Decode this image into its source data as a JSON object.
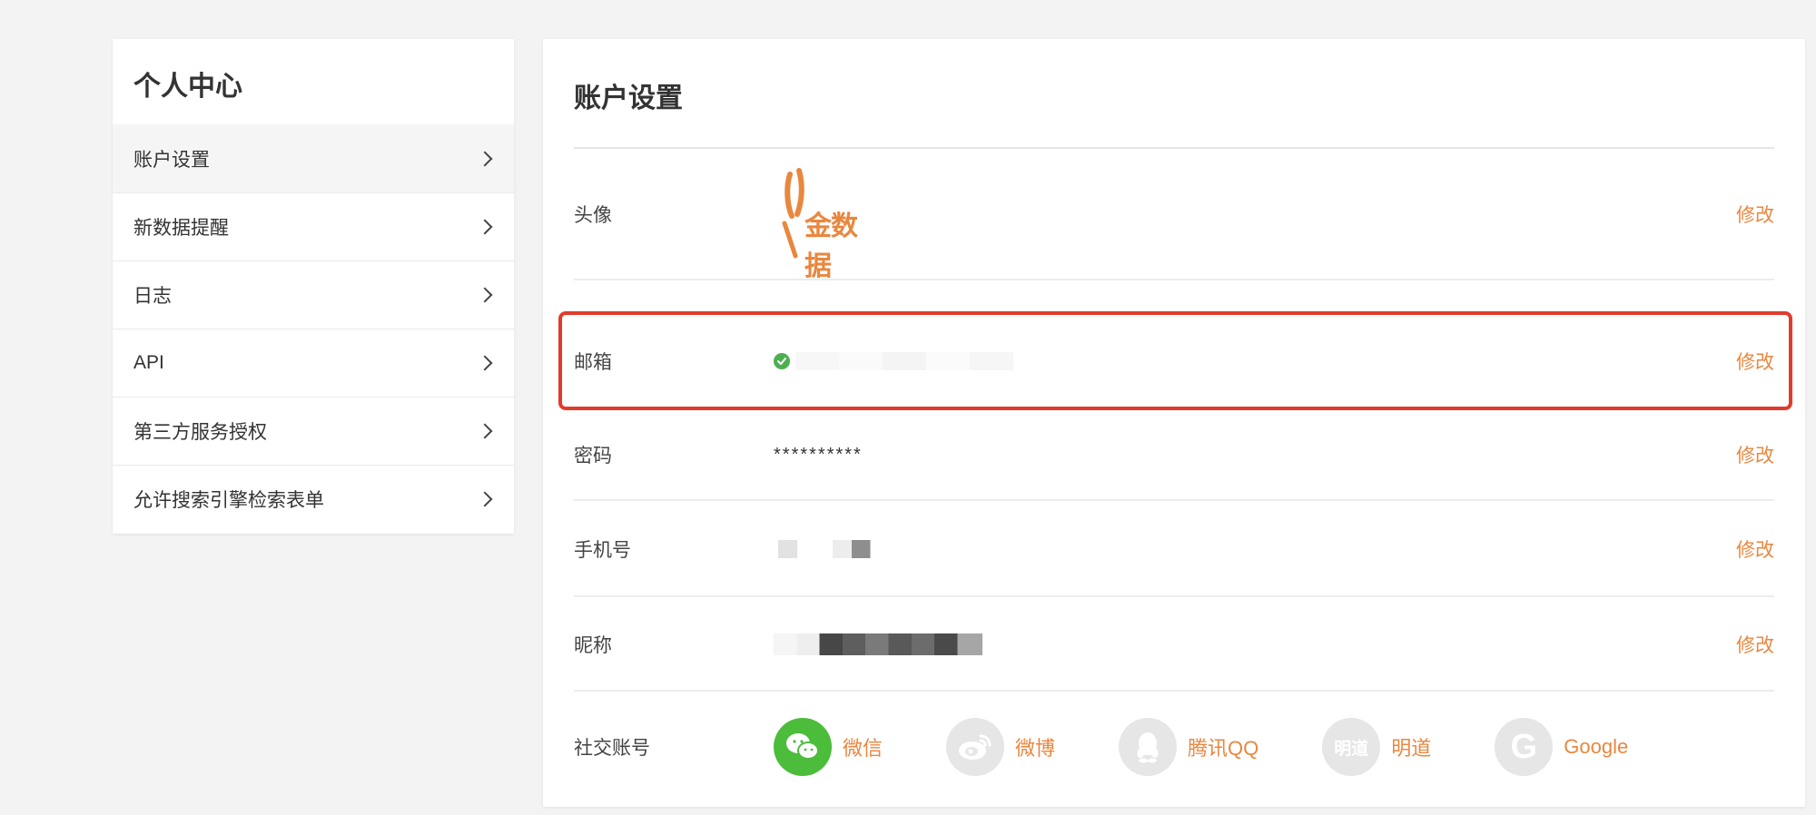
{
  "sidebar": {
    "title": "个人中心",
    "items": [
      {
        "label": "账户设置"
      },
      {
        "label": "新数据提醒"
      },
      {
        "label": "日志"
      },
      {
        "label": "API"
      },
      {
        "label": "第三方服务授权"
      },
      {
        "label": "允许搜索引擎检索表单"
      }
    ]
  },
  "main": {
    "title": "账户设置",
    "edit_label": "修改",
    "avatar": {
      "label": "头像",
      "logo_text": "金数据"
    },
    "email": {
      "label": "邮箱"
    },
    "password": {
      "label": "密码",
      "value": "**********"
    },
    "phone": {
      "label": "手机号"
    },
    "nickname": {
      "label": "昵称"
    },
    "social": {
      "label": "社交账号",
      "accounts": [
        {
          "name": "微信"
        },
        {
          "name": "微博"
        },
        {
          "name": "腾讯QQ"
        },
        {
          "name": "明道",
          "icon_text": "明道"
        },
        {
          "name": "Google",
          "icon_text": "G"
        }
      ]
    }
  },
  "colors": {
    "accent": "#e9873f",
    "highlight": "#e23b2b",
    "verified": "#4caf50",
    "wechat": "#4cbc3b"
  }
}
